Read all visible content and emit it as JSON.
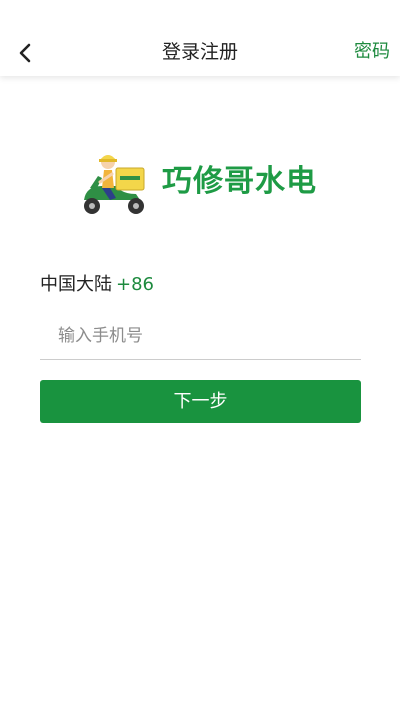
{
  "header": {
    "title": "登录注册",
    "password_link": "密码"
  },
  "logo": {
    "brand_name": "巧修哥水电",
    "brand_color": "#1e9b45"
  },
  "form": {
    "region_name": "中国大陆",
    "country_code": "+86",
    "phone_placeholder": "输入手机号",
    "phone_value": "",
    "next_label": "下一步"
  },
  "colors": {
    "accent": "#19933f",
    "link": "#1d8a3e"
  },
  "icons": {
    "back": "chevron-left-icon",
    "mascot": "scooter-mascot-icon"
  }
}
